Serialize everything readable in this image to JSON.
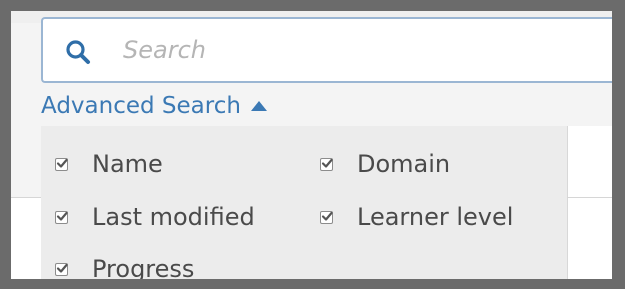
{
  "search": {
    "icon": "search-icon",
    "placeholder": "Search",
    "value": ""
  },
  "advanced_search": {
    "label": "Advanced Search",
    "icon": "caret-up-icon",
    "expanded": true
  },
  "filters": [
    {
      "label": "Name",
      "checked": true
    },
    {
      "label": "Domain",
      "checked": true
    },
    {
      "label": "Last modified",
      "checked": true
    },
    {
      "label": "Learner level",
      "checked": true
    },
    {
      "label": "Progress",
      "checked": true
    }
  ],
  "colors": {
    "accent": "#3b79b4",
    "frame": "#6b6b6b",
    "panel": "#ececec",
    "search_border": "#9bb6d3"
  }
}
